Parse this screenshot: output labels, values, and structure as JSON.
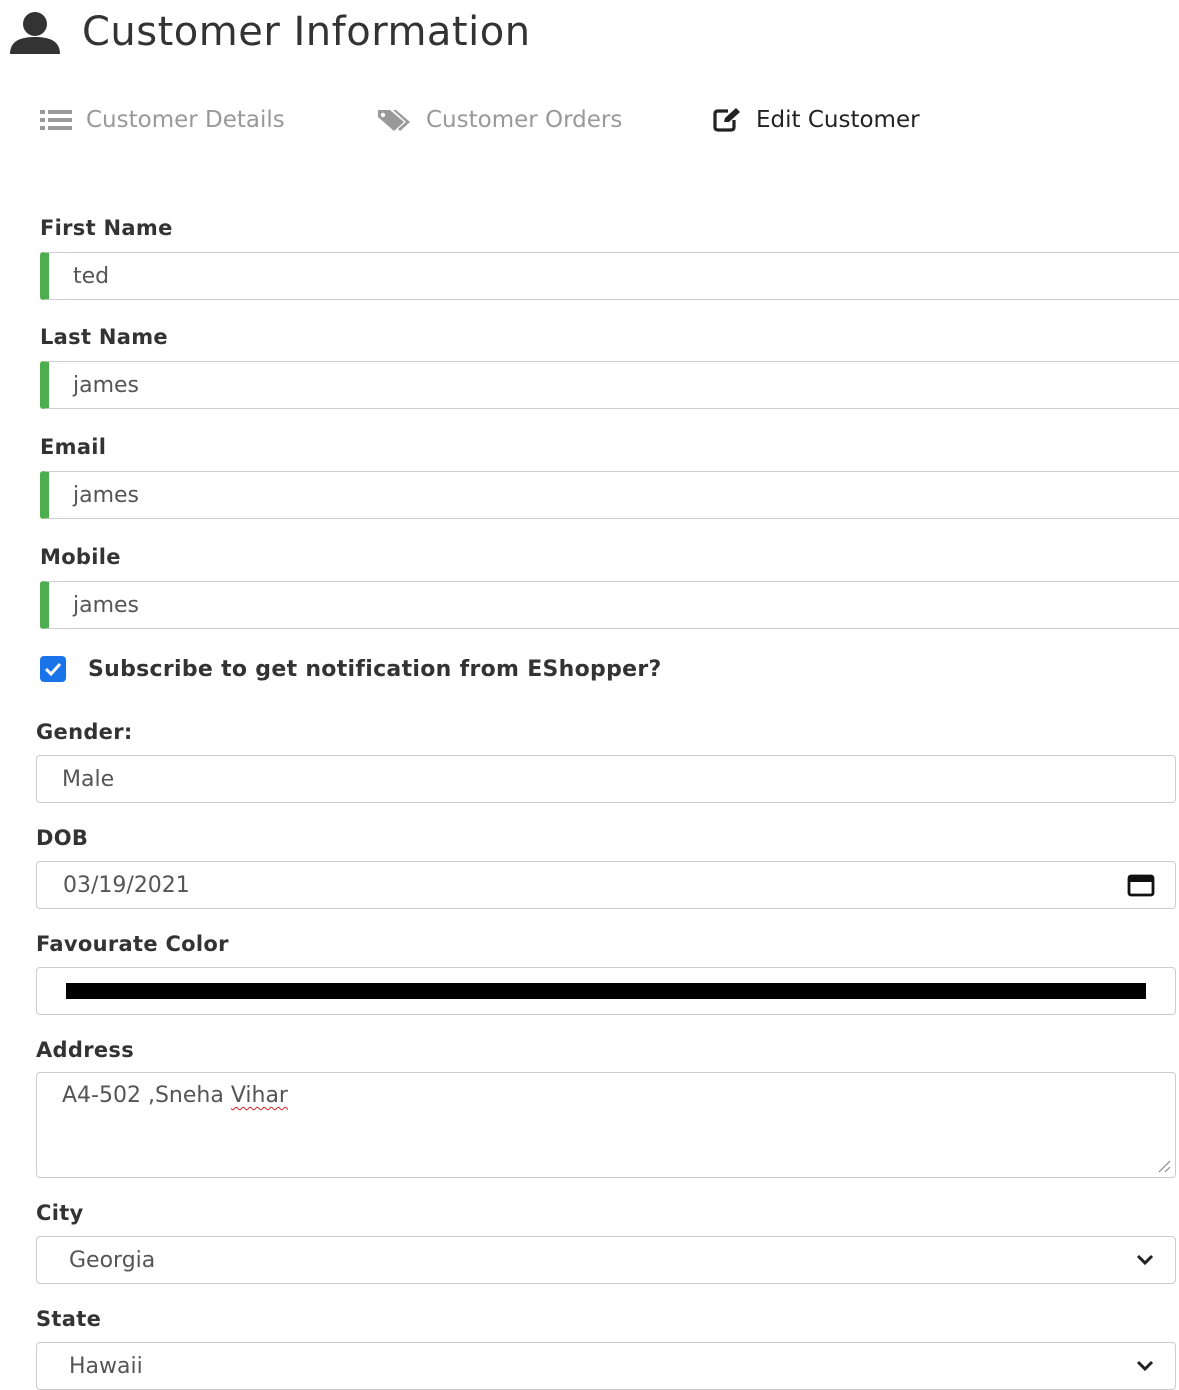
{
  "header": {
    "title": "Customer Information",
    "icon": "user-icon"
  },
  "tabs": [
    {
      "label": "Customer Details",
      "icon": "list-icon",
      "active": false
    },
    {
      "label": "Customer Orders",
      "icon": "tags-icon",
      "active": false
    },
    {
      "label": "Edit Customer",
      "icon": "edit-icon",
      "active": true
    }
  ],
  "form": {
    "first_name": {
      "label": "First Name",
      "value": "ted"
    },
    "last_name": {
      "label": "Last Name",
      "value": "james"
    },
    "email": {
      "label": "Email",
      "value": "james"
    },
    "mobile": {
      "label": "Mobile",
      "value": "james"
    },
    "subscribe": {
      "label": "Subscribe to get notification from EShopper?",
      "checked": true
    },
    "gender": {
      "label": "Gender:",
      "value": "Male"
    },
    "dob": {
      "label": "DOB",
      "value": "03/19/2021"
    },
    "favourite_color": {
      "label": "Favourate Color",
      "value": "#000000"
    },
    "address": {
      "label": "Address",
      "value_prefix": "A4-502 ,Sneha ",
      "value_misspelled": "Vihar"
    },
    "city": {
      "label": "City",
      "value": "Georgia"
    },
    "state": {
      "label": "State",
      "value": "Hawaii"
    }
  },
  "colors": {
    "valid_border": "#4cae4c",
    "checkbox": "#1a73e8",
    "muted_tab": "#999999"
  }
}
